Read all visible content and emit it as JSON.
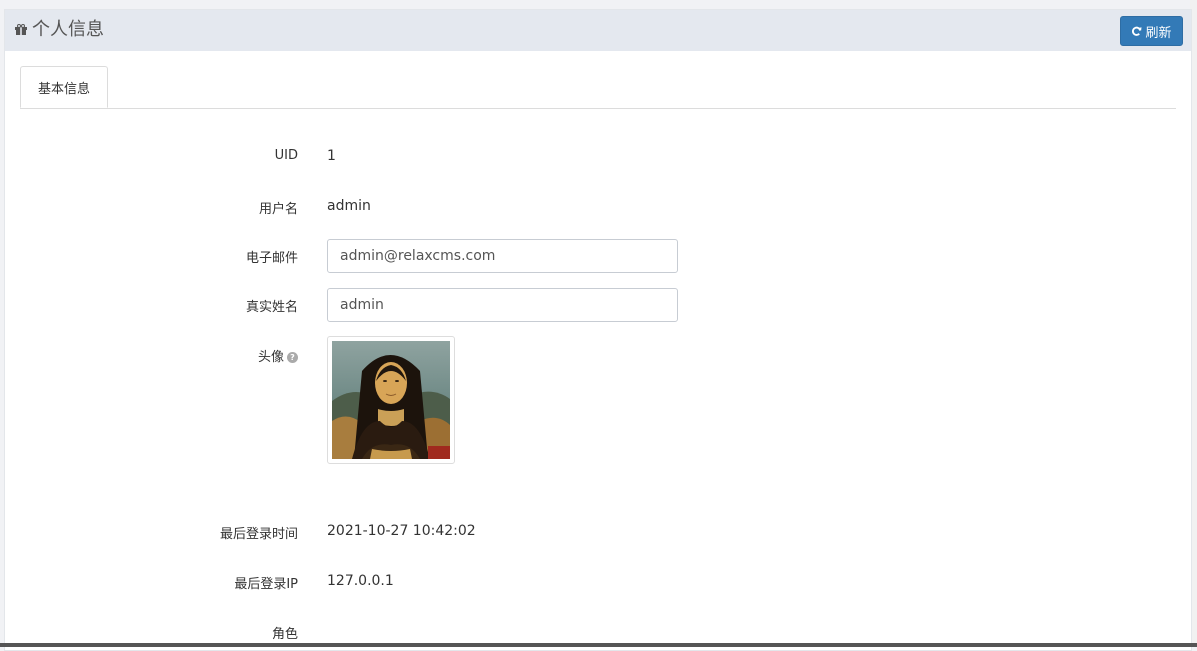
{
  "header": {
    "title": "个人信息",
    "refresh_label": "刷新",
    "accent_color": "#337ab7"
  },
  "tabs": [
    {
      "label": "基本信息",
      "active": true
    }
  ],
  "form": {
    "uid_label": "UID",
    "uid_value": "1",
    "username_label": "用户名",
    "username_value": "admin",
    "email_label": "电子邮件",
    "email_value": "admin@relaxcms.com",
    "realname_label": "真实姓名",
    "realname_value": "admin",
    "avatar_label": "头像",
    "avatar_help_icon": "question-circle-icon",
    "last_login_time_label": "最后登录时间",
    "last_login_time_value": "2021-10-27 10:42:02",
    "last_login_ip_label": "最后登录IP",
    "last_login_ip_value": "127.0.0.1",
    "role_label": "角色"
  },
  "icons": {
    "title": "gift-icon",
    "refresh": "refresh-icon"
  }
}
